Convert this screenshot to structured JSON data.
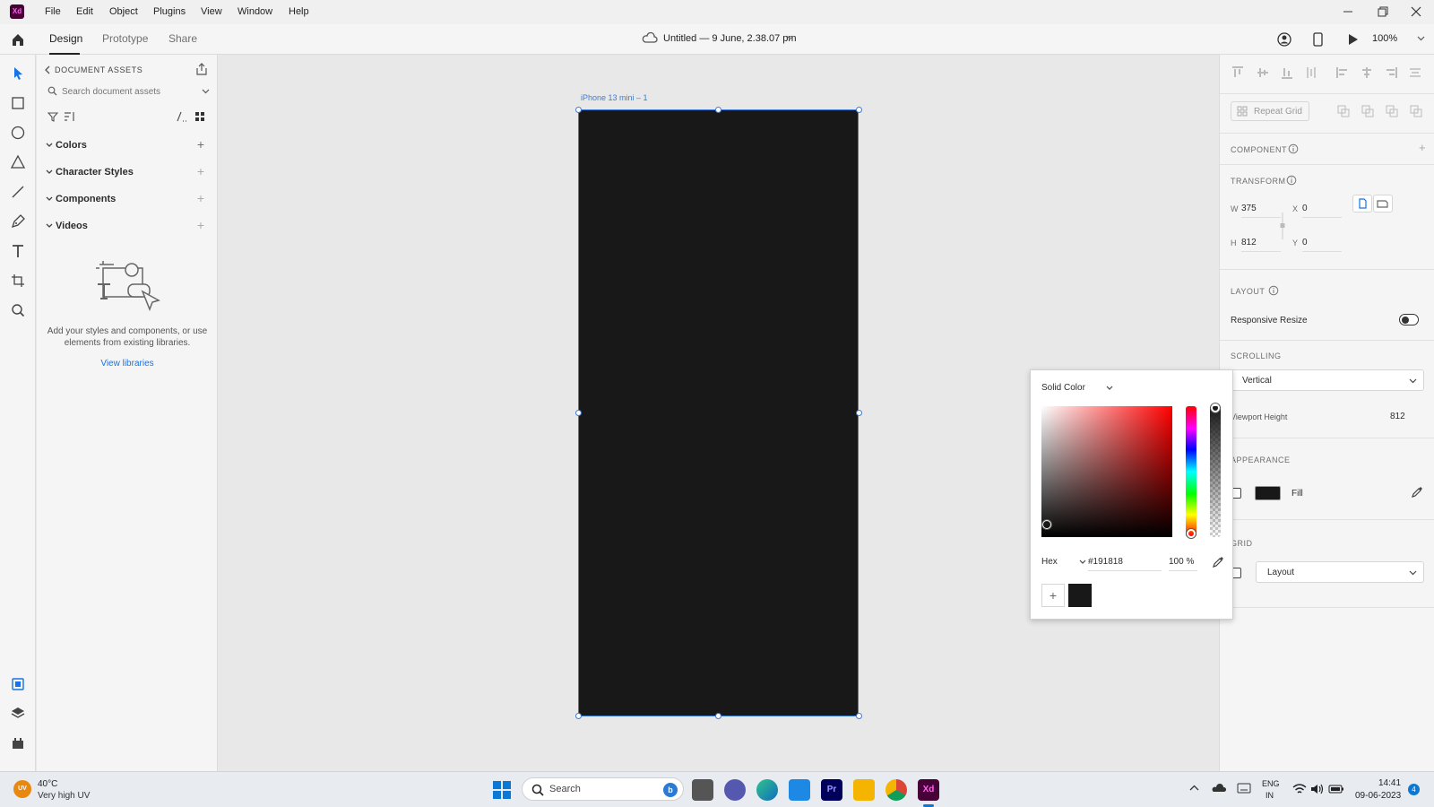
{
  "app": {
    "logo": "Xd",
    "title": "Untitled — 9 June, 2.38.07 pm",
    "zoom": "100%"
  },
  "menu": [
    "File",
    "Edit",
    "Object",
    "Plugins",
    "View",
    "Window",
    "Help"
  ],
  "tabs": [
    "Design",
    "Prototype",
    "Share"
  ],
  "assets": {
    "header": "DOCUMENT ASSETS",
    "search_placeholder": "Search document assets",
    "sections": [
      "Colors",
      "Character Styles",
      "Components",
      "Videos"
    ],
    "empty_text": "Add your styles and components, or use elements from existing libraries.",
    "link": "View libraries"
  },
  "artboard": {
    "name": "iPhone 13 mini – 1",
    "fill": "#191818"
  },
  "props": {
    "repeat_grid": "Repeat Grid",
    "component": "COMPONENT",
    "transform": "TRANSFORM",
    "w_label": "W",
    "w": "375",
    "h_label": "H",
    "h": "812",
    "x_label": "X",
    "x": "0",
    "y_label": "Y",
    "y": "0",
    "layout": "LAYOUT",
    "responsive": "Responsive Resize",
    "scrolling": "SCROLLING",
    "scroll_value": "Vertical",
    "viewport_label": "Viewport Height",
    "viewport_value": "812",
    "appearance": "APPEARANCE",
    "fill_label": "Fill",
    "grid": "GRID",
    "grid_value": "Layout"
  },
  "picker": {
    "mode": "Solid Color",
    "format": "Hex",
    "hex": "#191818",
    "opacity": "100 %",
    "swatch": "#191818"
  },
  "taskbar": {
    "weather_temp": "40°C",
    "weather_desc": "Very high UV",
    "weather_badge": "UV",
    "search": "Search",
    "lang1": "ENG",
    "lang2": "IN",
    "time": "14:41",
    "date": "09-06-2023",
    "notif": "4"
  },
  "colors": {
    "accent": "#1473e6",
    "artboard_border": "#3d7bd6",
    "xd_purple": "#470137",
    "xd_pink": "#ff61f6"
  }
}
